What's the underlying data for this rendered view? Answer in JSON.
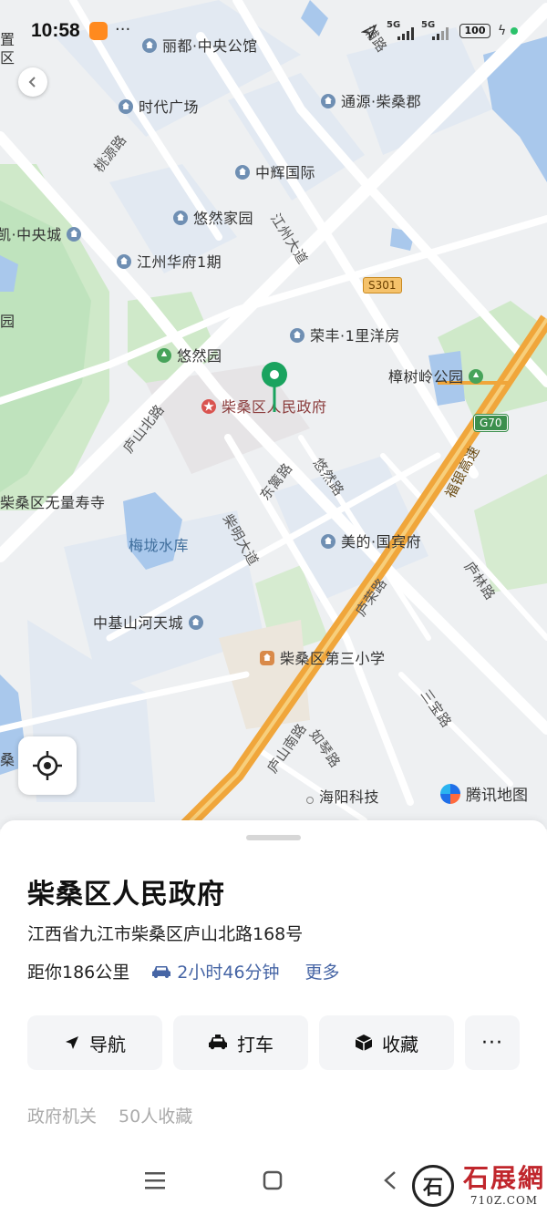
{
  "status_bar": {
    "time": "10:58",
    "network_1": "5G",
    "network_2": "5G",
    "battery": "100"
  },
  "map": {
    "places": [
      {
        "key": "lidu",
        "name": "丽都·中央公馆",
        "icon": "residential-icon"
      },
      {
        "key": "shidai",
        "name": "时代广场",
        "icon": "residential-icon"
      },
      {
        "key": "tongyuan",
        "name": "通源·柴桑郡",
        "icon": "residential-icon"
      },
      {
        "key": "zhonghui",
        "name": "中辉国际",
        "icon": "residential-icon"
      },
      {
        "key": "youran_jiayuan",
        "name": "悠然家园",
        "icon": "residential-icon"
      },
      {
        "key": "zhongyang",
        "name": "凯·中央城",
        "icon": "residential-icon"
      },
      {
        "key": "jiangzhou",
        "name": "江州华府1期",
        "icon": "residential-icon"
      },
      {
        "key": "rongfeng",
        "name": "荣丰·1里洋房",
        "icon": "residential-icon"
      },
      {
        "key": "youran_yuan",
        "name": "悠然园",
        "icon": "park-icon"
      },
      {
        "key": "zhangshuling",
        "name": "樟树岭公园",
        "icon": "park-icon"
      },
      {
        "key": "gov",
        "name": "柴桑区人民政府",
        "icon": "government-icon"
      },
      {
        "key": "wuliang",
        "name": "柴桑区无量寿寺",
        "icon": ""
      },
      {
        "key": "meilong",
        "name": "梅垅水库",
        "icon": ""
      },
      {
        "key": "meidi",
        "name": "美的·国宾府",
        "icon": "residential-icon"
      },
      {
        "key": "zhongji",
        "name": "中基山河天城",
        "icon": "residential-icon"
      },
      {
        "key": "school3",
        "name": "柴桑区第三小学",
        "icon": "school-icon"
      },
      {
        "key": "haiyang",
        "name": "海阳科技",
        "icon": "poi-dot-icon"
      },
      {
        "key": "school_left",
        "name": "桑  中学",
        "icon": ""
      },
      {
        "key": "yuan_left",
        "name": "园",
        "icon": ""
      },
      {
        "key": "zhi_left",
        "name": "置\n区",
        "icon": ""
      }
    ],
    "roads": {
      "jiangzhou_dadao": "江州大道",
      "lushan_beilu": "庐山北路",
      "donglin": "东篱路",
      "youran_lu": "悠然路",
      "limingdadao": "柴明大道",
      "lurong": "庐荣路",
      "lulin": "庐林路",
      "sanchong": "三宝路",
      "ruqin": "如琴路",
      "taobi": "桃源路",
      "puxi": "浦路",
      "fuyin_gaosu": "福银高速",
      "lushan_south": "庐山南路"
    },
    "shields": {
      "s301": "S301",
      "g70": "G70"
    },
    "attribution": "腾讯地图",
    "colors": {
      "water": "#a9c8ec",
      "park": "#bfe3bd",
      "highway": "#f0a63b",
      "pin": "#1aa35f"
    }
  },
  "card": {
    "title": "柴桑区人民政府",
    "address": "江西省九江市柴桑区庐山北路168号",
    "distance": "距你186公里",
    "drive_time": "2小时46分钟",
    "more": "更多",
    "buttons": {
      "navigate": "导航",
      "taxi": "打车",
      "favorite": "收藏",
      "more": "···"
    },
    "category": "政府机关",
    "favorites_count": "50人收藏"
  },
  "watermark": {
    "brand_cn": "石展網",
    "brand_url": "710Z.COM",
    "brand_mark": "石"
  }
}
